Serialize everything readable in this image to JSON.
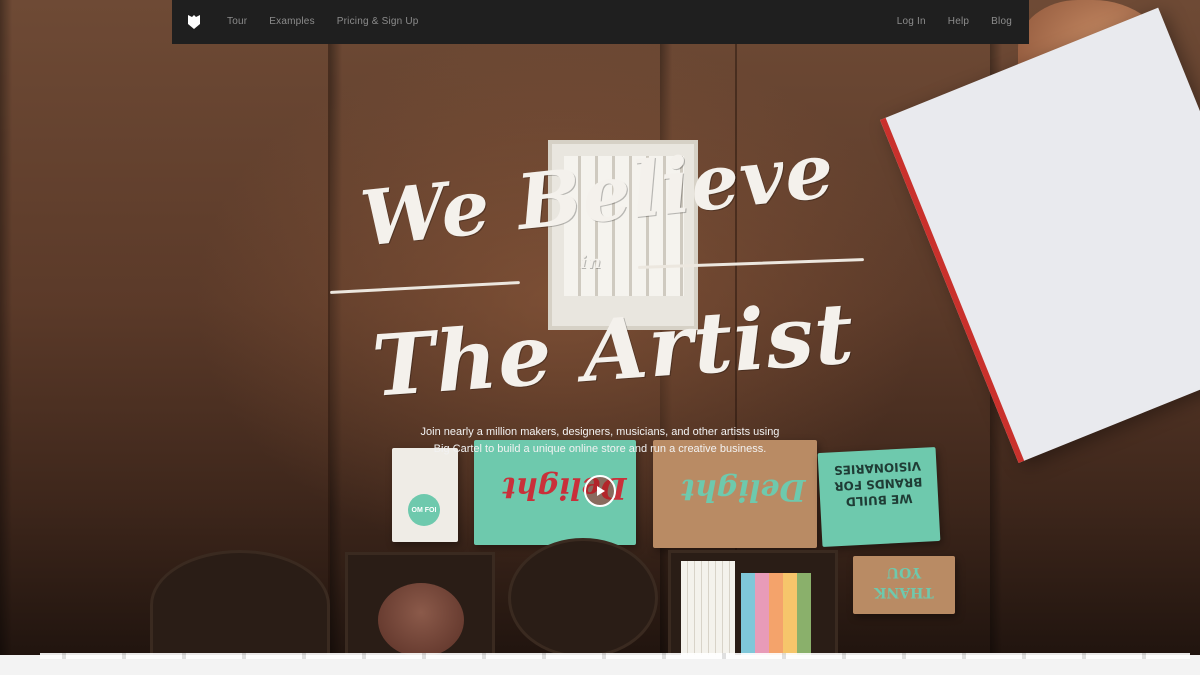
{
  "nav": {
    "logo_icon": "big-cartel-shield-icon",
    "left_links": [
      "Tour",
      "Examples",
      "Pricing & Sign Up"
    ],
    "right_links": [
      "Log In",
      "Help",
      "Blog"
    ]
  },
  "hero": {
    "headline_line1": "We Believe",
    "headline_line2": "in",
    "headline_line3": "The Artist",
    "subtext_line1": "Join nearly a million makers, designers, musicians, and other artists using",
    "subtext_line2": "Big Cartel to build a unique online store and run a creative business.",
    "play_icon": "play-icon"
  },
  "props": {
    "card_1": "Delight",
    "card_2": "Delight",
    "card_3_line1": "WE BUILD",
    "card_3_line2": "BRANDS FOR",
    "card_3_line3": "VISIONARIES",
    "card_4_line1": "THANK",
    "card_4_line2": "YOU",
    "card_5": "OM FOI"
  },
  "colors": {
    "nav_bg": "#1f1f1f",
    "nav_text": "#8c8c8c",
    "headline": "#f4f1ec",
    "mint": "#6ec9ad",
    "accent_red": "#c9303a"
  }
}
